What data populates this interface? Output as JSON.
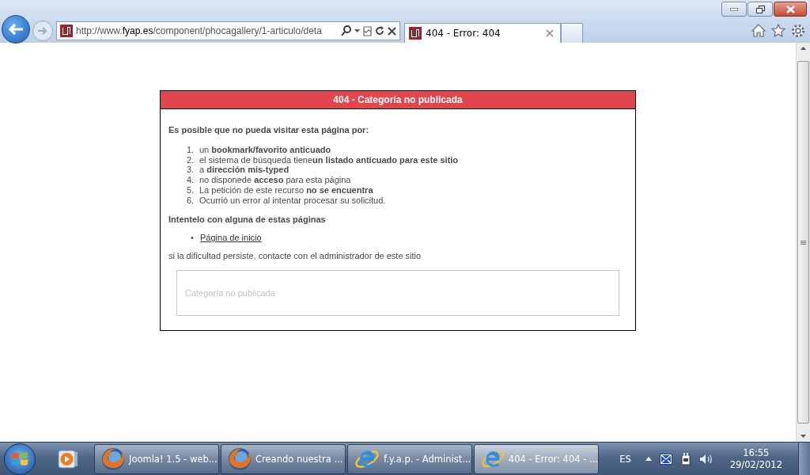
{
  "address_bar": {
    "url": "http://www.**fyap.es**/component/phocagallery/1-articulo/deta"
  },
  "tabs": [
    {
      "label": "404 - Error: 404",
      "selected": true
    }
  ],
  "page": {
    "heading": "404 - Categoría no publicada",
    "intro": "Es posible que no pueda visitar esta página por:",
    "reasons": [
      {
        "number": "1.",
        "text": "un **bookmark/favorito anticuado**"
      },
      {
        "number": "2.",
        "text": "el sistema de búsqueda tiene**un listado anticuado para este sitio**"
      },
      {
        "number": "3.",
        "text": "a **dirección mis-typed**"
      },
      {
        "number": "4.",
        "text": "no disponede **acceso** para esta página"
      },
      {
        "number": "5.",
        "text": "La petición de este recurso **no se encuentra**"
      },
      {
        "number": "6.",
        "text": "Ocurrió un error al intentar procesar su solicitud."
      }
    ],
    "suggestion_heading": "Intentelo con alguna de estas páginas",
    "links": [
      {
        "bullet": "•",
        "label": "Página de inicio"
      }
    ],
    "contact": "si la dificultad persiste, contacte con el administrador de este sitio",
    "message_box": "Categoría no publicada"
  },
  "taskbar": {
    "items": [
      {
        "kind": "firefox",
        "label": "Joomla! 1.5 - web...",
        "selected": false
      },
      {
        "kind": "firefox",
        "label": "Creando nuestra ...",
        "selected": false
      },
      {
        "kind": "ie",
        "label": "f.y.a.p. - Administ...",
        "selected": false
      },
      {
        "kind": "ie",
        "label": "404 - Error: 404 - ...",
        "selected": true
      }
    ],
    "language": "ES",
    "time": "16:55",
    "date": "29/02/2012"
  }
}
